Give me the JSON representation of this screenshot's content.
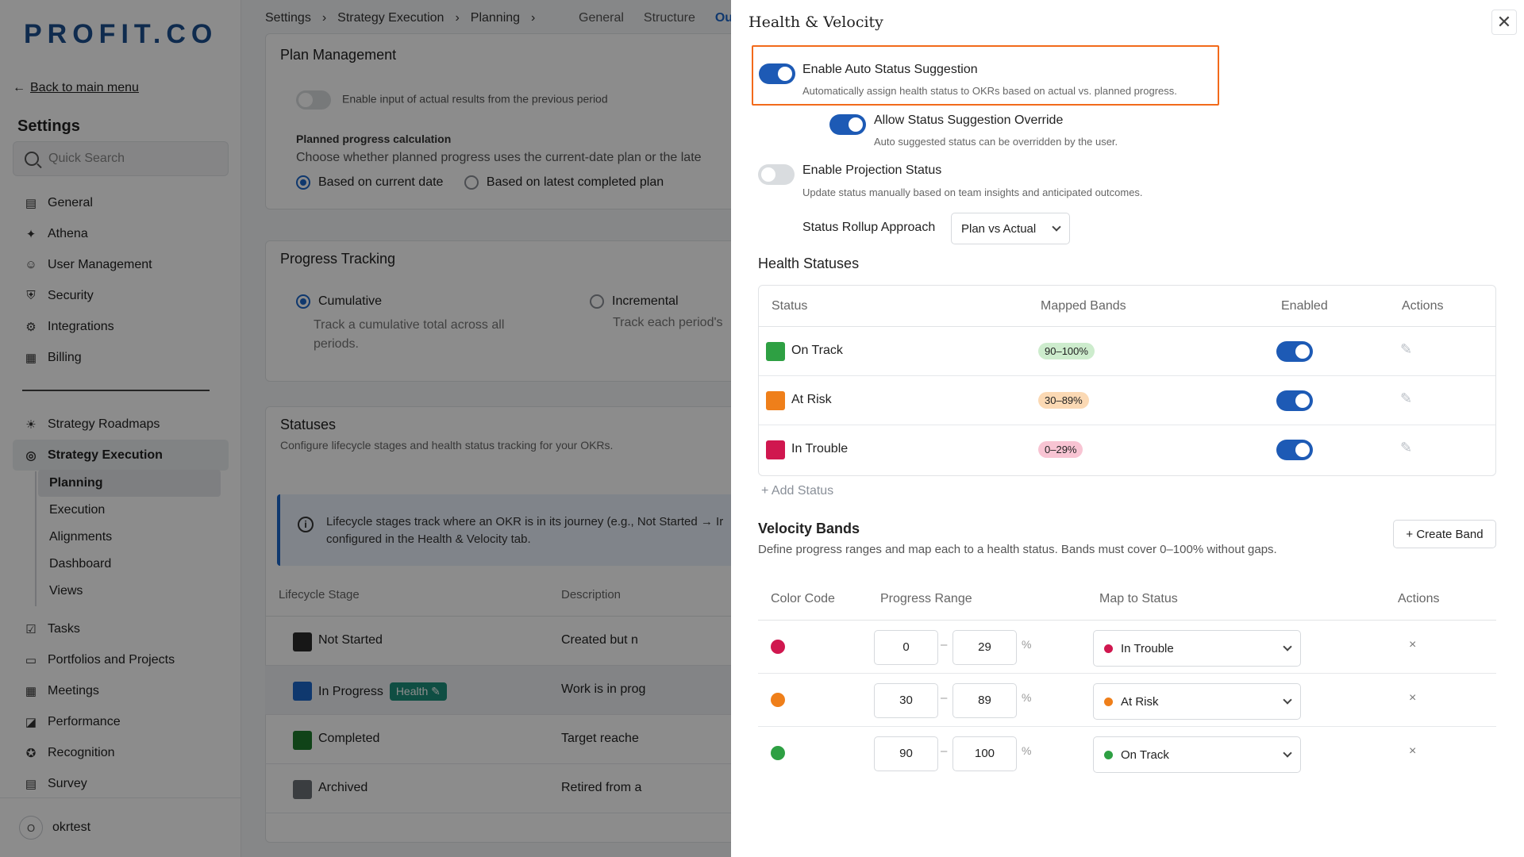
{
  "app": {
    "logo": "PROFIT.CO",
    "back_link": "Back to main menu",
    "settings_heading": "Settings",
    "search_placeholder": "Quick Search"
  },
  "sidebar": {
    "top_items": [
      {
        "label": "General",
        "icon": "grid-icon"
      },
      {
        "label": "Athena",
        "icon": "sparkle-icon"
      },
      {
        "label": "User Management",
        "icon": "user-icon"
      },
      {
        "label": "Security",
        "icon": "shield-icon"
      },
      {
        "label": "Integrations",
        "icon": "gear-icon"
      },
      {
        "label": "Billing",
        "icon": "receipt-icon"
      }
    ],
    "mid_items": [
      {
        "label": "Strategy Roadmaps",
        "icon": "lightbulb-icon"
      },
      {
        "label": "Strategy Execution",
        "icon": "target-icon"
      }
    ],
    "sub_items": [
      "Planning",
      "Execution",
      "Alignments",
      "Dashboard",
      "Views"
    ],
    "bottom_items": [
      {
        "label": "Tasks",
        "icon": "checklist-icon"
      },
      {
        "label": "Portfolios and Projects",
        "icon": "briefcase-icon"
      },
      {
        "label": "Meetings",
        "icon": "calendar-icon"
      },
      {
        "label": "Performance",
        "icon": "chart-icon"
      },
      {
        "label": "Recognition",
        "icon": "award-icon"
      },
      {
        "label": "Survey",
        "icon": "survey-icon"
      }
    ],
    "user": {
      "initial": "O",
      "name": "okrtest"
    }
  },
  "main": {
    "breadcrumb": [
      "Settings",
      "›",
      "Strategy Execution",
      "›",
      "Planning",
      "›"
    ],
    "tabs": [
      "General",
      "Structure",
      "Out"
    ],
    "plan_management": {
      "title": "Plan Management",
      "toggle_label": "Enable input of actual results from the previous period",
      "planned_heading": "Planned progress calculation",
      "planned_desc": "Choose whether planned progress uses the current-date plan or the late",
      "radio_current": "Based on current date",
      "radio_latest": "Based on latest completed plan"
    },
    "progress_tracking": {
      "title": "Progress Tracking",
      "cumulative": "Cumulative",
      "cumulative_desc_1": "Track a cumulative total across all",
      "cumulative_desc_2": "periods.",
      "incremental": "Incremental",
      "incremental_desc": "Track each period's"
    },
    "statuses": {
      "title": "Statuses",
      "subtitle": "Configure lifecycle stages and health status tracking for your OKRs.",
      "info_line_1": "Lifecycle stages track where an OKR is in its journey (e.g., Not Started → Ir",
      "info_line_2": "configured in the Health & Velocity tab.",
      "col_stage": "Lifecycle Stage",
      "col_desc": "Description",
      "rows": [
        {
          "name": "Not Started",
          "desc": "Created but n",
          "color": "#2b2b2b"
        },
        {
          "name": "In Progress",
          "desc": "Work is in prog",
          "color": "#1d67c9",
          "badge": "Health"
        },
        {
          "name": "Completed",
          "desc": "Target reache",
          "color": "#1e7a2c"
        },
        {
          "name": "Archived",
          "desc": "Retired from a",
          "color": "#6b6f75"
        }
      ]
    }
  },
  "panel": {
    "title": "Health & Velocity",
    "auto_status": {
      "title": "Enable Auto Status Suggestion",
      "desc": "Automatically assign health status to OKRs based on actual vs. planned progress.",
      "on": true
    },
    "override": {
      "title": "Allow Status Suggestion Override",
      "desc": "Auto suggested status can be overridden by the user.",
      "on": true
    },
    "projection": {
      "title": "Enable Projection Status",
      "desc": "Update status manually based on team insights and anticipated outcomes.",
      "on": false
    },
    "rollup": {
      "label": "Status Rollup Approach",
      "value": "Plan vs Actual"
    },
    "health_statuses": {
      "heading": "Health Statuses",
      "columns": [
        "Status",
        "Mapped Bands",
        "Enabled",
        "Actions"
      ],
      "rows": [
        {
          "name": "On Track",
          "band": "90–100%",
          "color": "#2ea043",
          "pill_bg": "#cdeccd",
          "enabled": true
        },
        {
          "name": "At Risk",
          "band": "30–89%",
          "color": "#ef7f1a",
          "pill_bg": "#fbd9b4",
          "enabled": true
        },
        {
          "name": "In Trouble",
          "band": "0–29%",
          "color": "#d0174f",
          "pill_bg": "#f8c4d3",
          "enabled": true
        }
      ],
      "add_label": "+ Add Status"
    },
    "velocity_bands": {
      "heading": "Velocity Bands",
      "desc": "Define progress ranges and map each to a health status. Bands must cover 0–100% without gaps.",
      "create_label": "+ Create Band",
      "columns": [
        "Color Code",
        "Progress Range",
        "Map to Status",
        "Actions"
      ],
      "rows": [
        {
          "color": "#d0174f",
          "from": "0",
          "to": "29",
          "status": "In Trouble"
        },
        {
          "color": "#ef7f1a",
          "from": "30",
          "to": "89",
          "status": "At Risk"
        },
        {
          "color": "#2ea043",
          "from": "90",
          "to": "100",
          "status": "On Track"
        }
      ],
      "dash": "–",
      "pct": "%",
      "remove": "×"
    }
  }
}
